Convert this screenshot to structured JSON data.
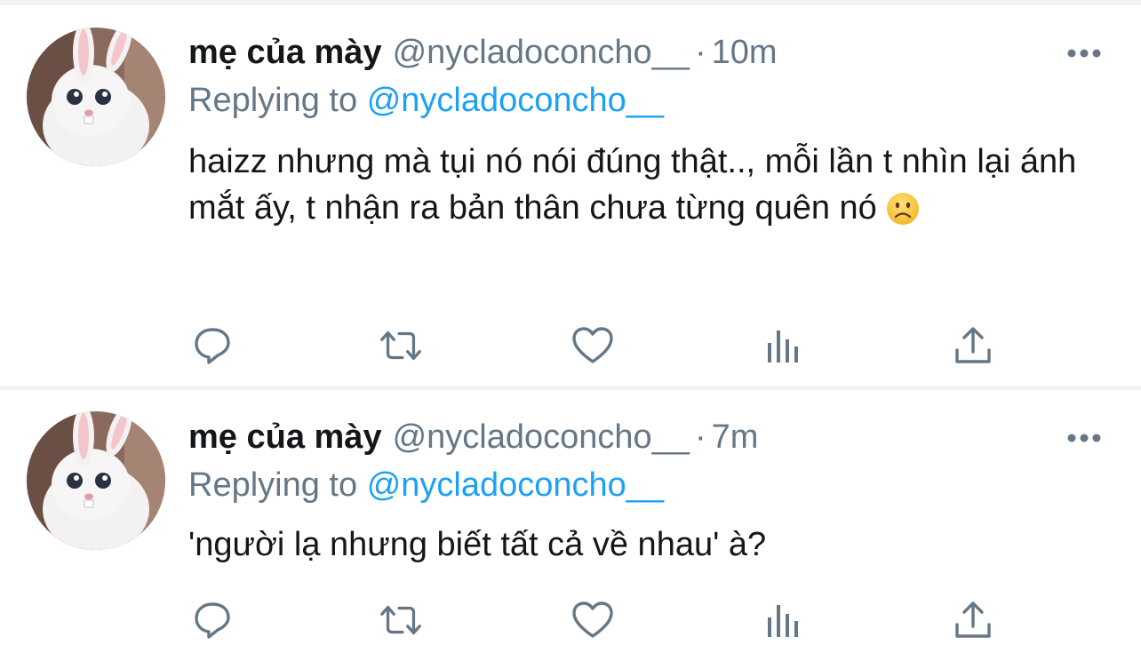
{
  "colors": {
    "text_primary": "#14171a",
    "text_secondary": "#657786",
    "link": "#1da1f2",
    "divider": "#eff3f4"
  },
  "tweets": [
    {
      "display_name": "mẹ của mày",
      "handle": "@nycladoconcho__",
      "separator": "·",
      "time": "10m",
      "replying_label": "Replying to",
      "replying_handle": "@nycladoconcho__",
      "text": "haizz nhưng mà tụi nó nói đúng thật.., mỗi lần t nhìn lại ánh mắt ấy, t nhận ra bản thân chưa từng quên nó",
      "emoji": "slightly-frowning-face",
      "actions": [
        "reply-icon",
        "retweet-icon",
        "like-icon",
        "analytics-icon",
        "share-icon"
      ]
    },
    {
      "display_name": "mẹ của mày",
      "handle": "@nycladoconcho__",
      "separator": "·",
      "time": "7m",
      "replying_label": "Replying to",
      "replying_handle": "@nycladoconcho__",
      "text": "'người lạ nhưng biết tất cả về nhau' à?",
      "actions": [
        "reply-icon",
        "retweet-icon",
        "like-icon",
        "analytics-icon",
        "share-icon"
      ]
    }
  ]
}
